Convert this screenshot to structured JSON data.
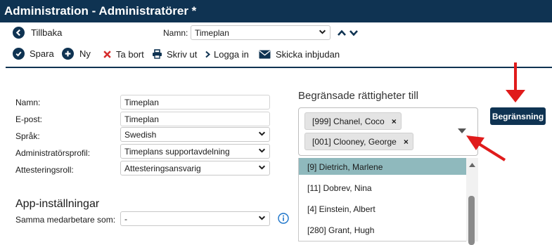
{
  "window": {
    "title": "Administration - Administratörer *"
  },
  "nav": {
    "back_label": "Tillbaka",
    "name_label": "Namn:",
    "name_select_value": "Timeplan"
  },
  "toolbar": {
    "save_label": "Spara",
    "new_label": "Ny",
    "delete_label": "Ta bort",
    "print_label": "Skriv ut",
    "login_label": "Logga in",
    "invite_label": "Skicka inbjudan"
  },
  "form": {
    "name_label": "Namn:",
    "name_value": "Timeplan",
    "email_label": "E-post:",
    "email_value": "Timeplan",
    "language_label": "Språk:",
    "language_value": "Swedish",
    "profile_label": "Administratörsprofil:",
    "profile_value": "Timeplans supportavdelning",
    "attest_label": "Attesteringsroll:",
    "attest_value": "Attesteringsansvarig"
  },
  "app_settings": {
    "title": "App-inställningar",
    "same_staff_label": "Samma medarbetare som:",
    "same_staff_value": "-"
  },
  "restrictions": {
    "title": "Begränsade rättigheter till",
    "selected": [
      {
        "label": "[999] Chanel, Coco"
      },
      {
        "label": "[001] Clooney, George"
      }
    ],
    "options": [
      {
        "label": "[9] Dietrich, Marlene",
        "highlighted": true
      },
      {
        "label": "[11] Dobrev, Nina",
        "highlighted": false
      },
      {
        "label": "[4] Einstein, Albert",
        "highlighted": false
      },
      {
        "label": "[280] Grant, Hugh",
        "highlighted": false
      }
    ],
    "button_label": "Begränsning"
  },
  "colors": {
    "brand": "#0f3352",
    "delete": "#d62b2b",
    "arrow": "#e01b1b",
    "highlight": "#8fb9bd",
    "info": "#1a73c9"
  },
  "icons": {
    "back": "arrow-left-circle-icon",
    "save": "check-circle-icon",
    "new": "plus-circle-icon",
    "delete": "x-icon",
    "print": "printer-icon",
    "login": "chevron-right-icon",
    "invite": "envelope-icon",
    "info": "info-circle-icon"
  }
}
